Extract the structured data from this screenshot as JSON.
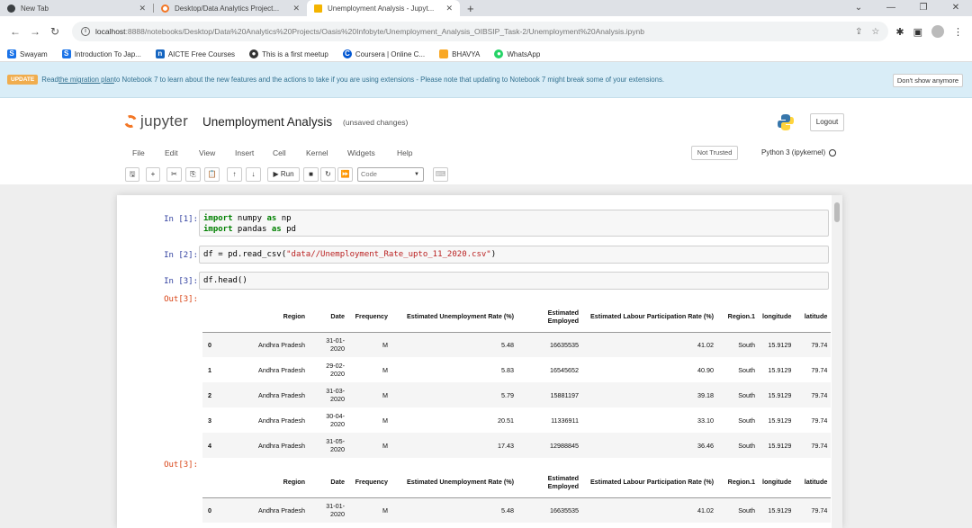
{
  "browser": {
    "tabs": [
      {
        "label": "New Tab",
        "icon_color": "#3c4043"
      },
      {
        "label": "Desktop/Data Analytics Project...",
        "icon_color": "#f37726"
      },
      {
        "label": "Unemployment Analysis - Jupyt...",
        "icon_color": "#f4b400"
      }
    ],
    "new_tab": "+",
    "url_host": "localhost",
    "url_rest": ":8888/notebooks/Desktop/Data%20Analytics%20Projects/Oasis%20Infobyte/Unemployment_Analysis_OIBSIP_Task-2/Unemployment%20Analysis.ipynb",
    "bookmarks": [
      {
        "label": "Swayam",
        "color": "#1a73e8"
      },
      {
        "label": "Introduction To Jap...",
        "color": "#1a73e8"
      },
      {
        "label": "AICTE Free Courses",
        "color": "#1565c0"
      },
      {
        "label": "This is a first meetup",
        "color": "#333333"
      },
      {
        "label": "Coursera | Online C...",
        "color": "#0056d2"
      },
      {
        "label": "BHAVYA",
        "color": "#f9a825"
      },
      {
        "label": "WhatsApp",
        "color": "#25d366"
      }
    ]
  },
  "banner": {
    "badge": "UPDATE",
    "text_before": "Read ",
    "link": "the migration plan",
    "text_after": " to Notebook 7 to learn about the new features and the actions to take if you are using extensions - Please note that updating to Notebook 7 might break some of your extensions.",
    "dismiss": "Don't show anymore"
  },
  "jupyter": {
    "logo": "jupyter",
    "title": "Unemployment Analysis",
    "saved_status": "(unsaved changes)",
    "logout": "Logout",
    "menu": [
      "File",
      "Edit",
      "View",
      "Insert",
      "Cell",
      "Kernel",
      "Widgets",
      "Help"
    ],
    "trusted": "Not Trusted",
    "kernel": "Python 3 (ipykernel)",
    "run_label": "Run",
    "cell_type": "Code"
  },
  "cells": {
    "c1_prompt": "In [1]:",
    "c1_line1_kw": "import",
    "c1_line1_mod": " numpy ",
    "c1_line1_as": "as",
    "c1_line1_alias": " np",
    "c1_line2_kw": "import",
    "c1_line2_mod": " pandas ",
    "c1_line2_as": "as",
    "c1_line2_alias": " pd",
    "c2_prompt": "In [2]:",
    "c2_code_pre": "df = pd.read_csv(",
    "c2_code_str": "\"data//Unemployment_Rate_upto_11_2020.csv\"",
    "c2_code_post": ")",
    "c3_prompt": "In [3]:",
    "c3_code": "df.head()",
    "out3_prompt": "Out[3]:",
    "out3b_prompt": "Out[3]:"
  },
  "table": {
    "headers": [
      "",
      "Region",
      "Date",
      "Frequency",
      "Estimated Unemployment Rate (%)",
      "Estimated Employed",
      "Estimated Labour Participation Rate (%)",
      "Region.1",
      "longitude",
      "latitude"
    ],
    "rows": [
      [
        "0",
        "Andhra Pradesh",
        "31-01-2020",
        "M",
        "5.48",
        "16635535",
        "41.02",
        "South",
        "15.9129",
        "79.74"
      ],
      [
        "1",
        "Andhra Pradesh",
        "29-02-2020",
        "M",
        "5.83",
        "16545652",
        "40.90",
        "South",
        "15.9129",
        "79.74"
      ],
      [
        "2",
        "Andhra Pradesh",
        "31-03-2020",
        "M",
        "5.79",
        "15881197",
        "39.18",
        "South",
        "15.9129",
        "79.74"
      ],
      [
        "3",
        "Andhra Pradesh",
        "30-04-2020",
        "M",
        "20.51",
        "11336911",
        "33.10",
        "South",
        "15.9129",
        "79.74"
      ],
      [
        "4",
        "Andhra Pradesh",
        "31-05-2020",
        "M",
        "17.43",
        "12988845",
        "36.46",
        "South",
        "15.9129",
        "79.74"
      ]
    ],
    "row2": [
      "0",
      "Andhra Pradesh",
      "31-01-2020",
      "M",
      "5.48",
      "16635535",
      "41.02",
      "South",
      "15.9129",
      "79.74"
    ]
  }
}
